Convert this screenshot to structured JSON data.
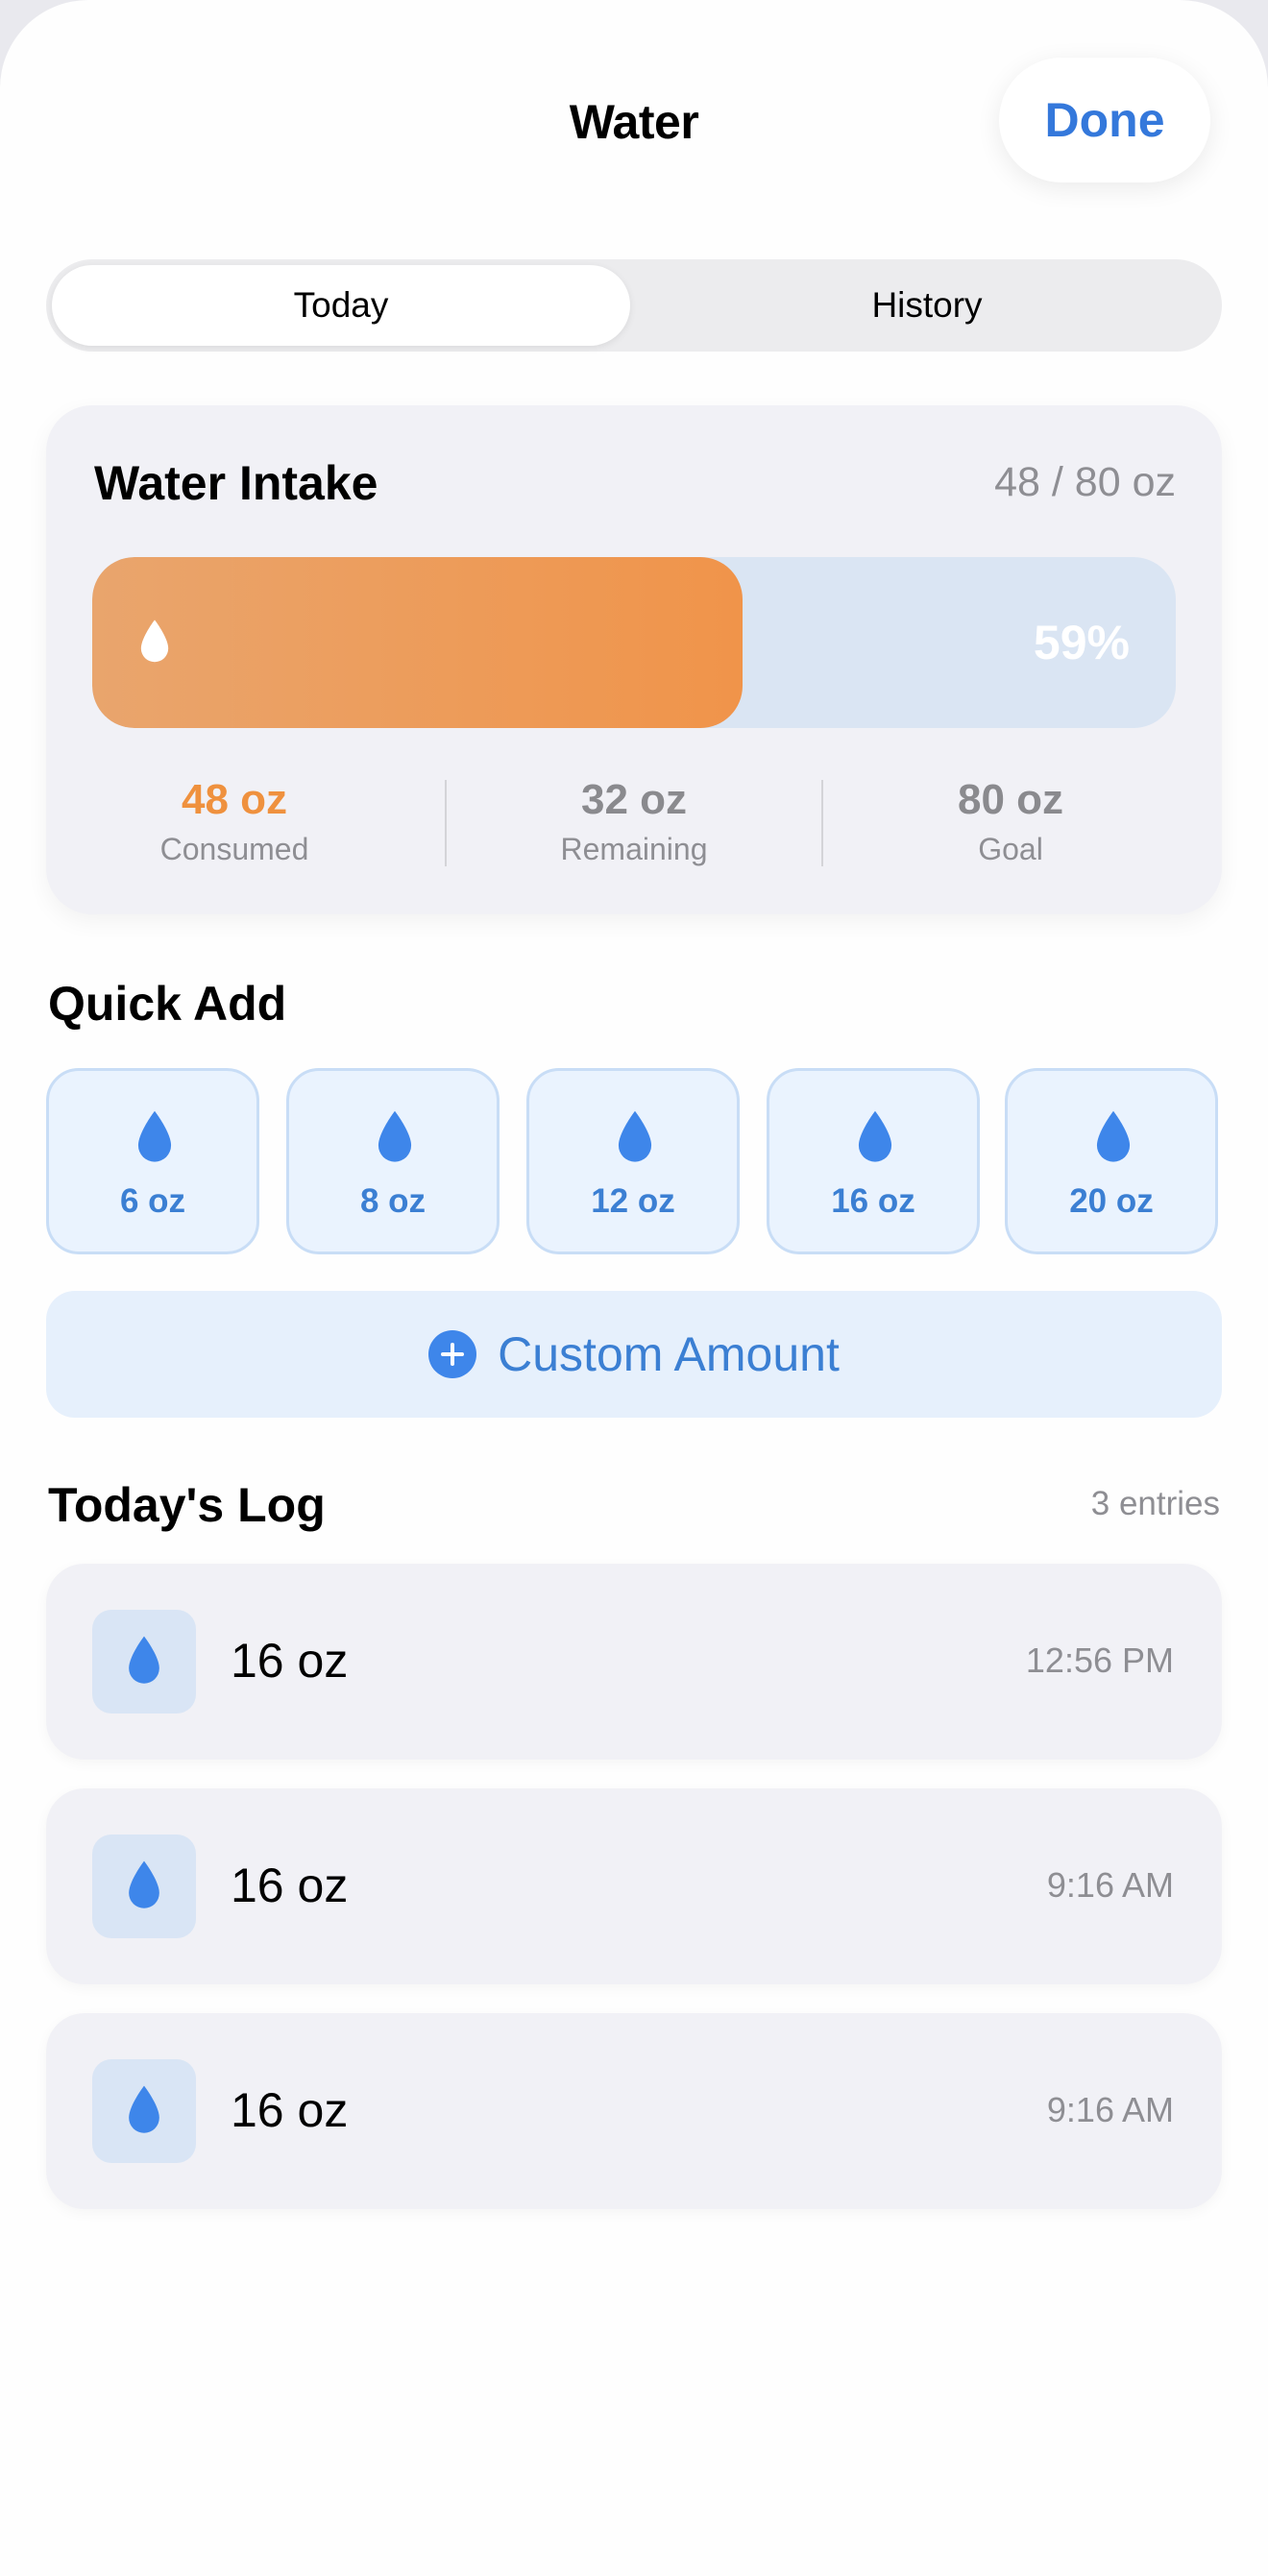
{
  "header": {
    "title": "Water",
    "done_label": "Done"
  },
  "tabs": {
    "today": "Today",
    "history": "History",
    "selected": "Today"
  },
  "intake": {
    "title": "Water Intake",
    "total_text": "48 / 80 oz",
    "progress_fraction": 0.6,
    "percent_label": "59%",
    "consumed": {
      "value": "48 oz",
      "label": "Consumed"
    },
    "remaining": {
      "value": "32 oz",
      "label": "Remaining"
    },
    "goal": {
      "value": "80 oz",
      "label": "Goal"
    }
  },
  "quick_add": {
    "title": "Quick Add",
    "buttons": [
      "6 oz",
      "8 oz",
      "12 oz",
      "16 oz",
      "20 oz"
    ],
    "custom_label": "Custom Amount"
  },
  "log": {
    "title": "Today's Log",
    "count_text": "3 entries",
    "entries": [
      {
        "amount": "16 oz",
        "time": "12:56 PM"
      },
      {
        "amount": "16 oz",
        "time": "9:16 AM"
      },
      {
        "amount": "16 oz",
        "time": "9:16 AM"
      }
    ]
  },
  "icons": {
    "drop": "water-drop-icon",
    "plus": "plus-circle-icon"
  },
  "colors": {
    "accent": "#3478db",
    "consumed": "#ef913e",
    "drop": "#3e86ea"
  }
}
